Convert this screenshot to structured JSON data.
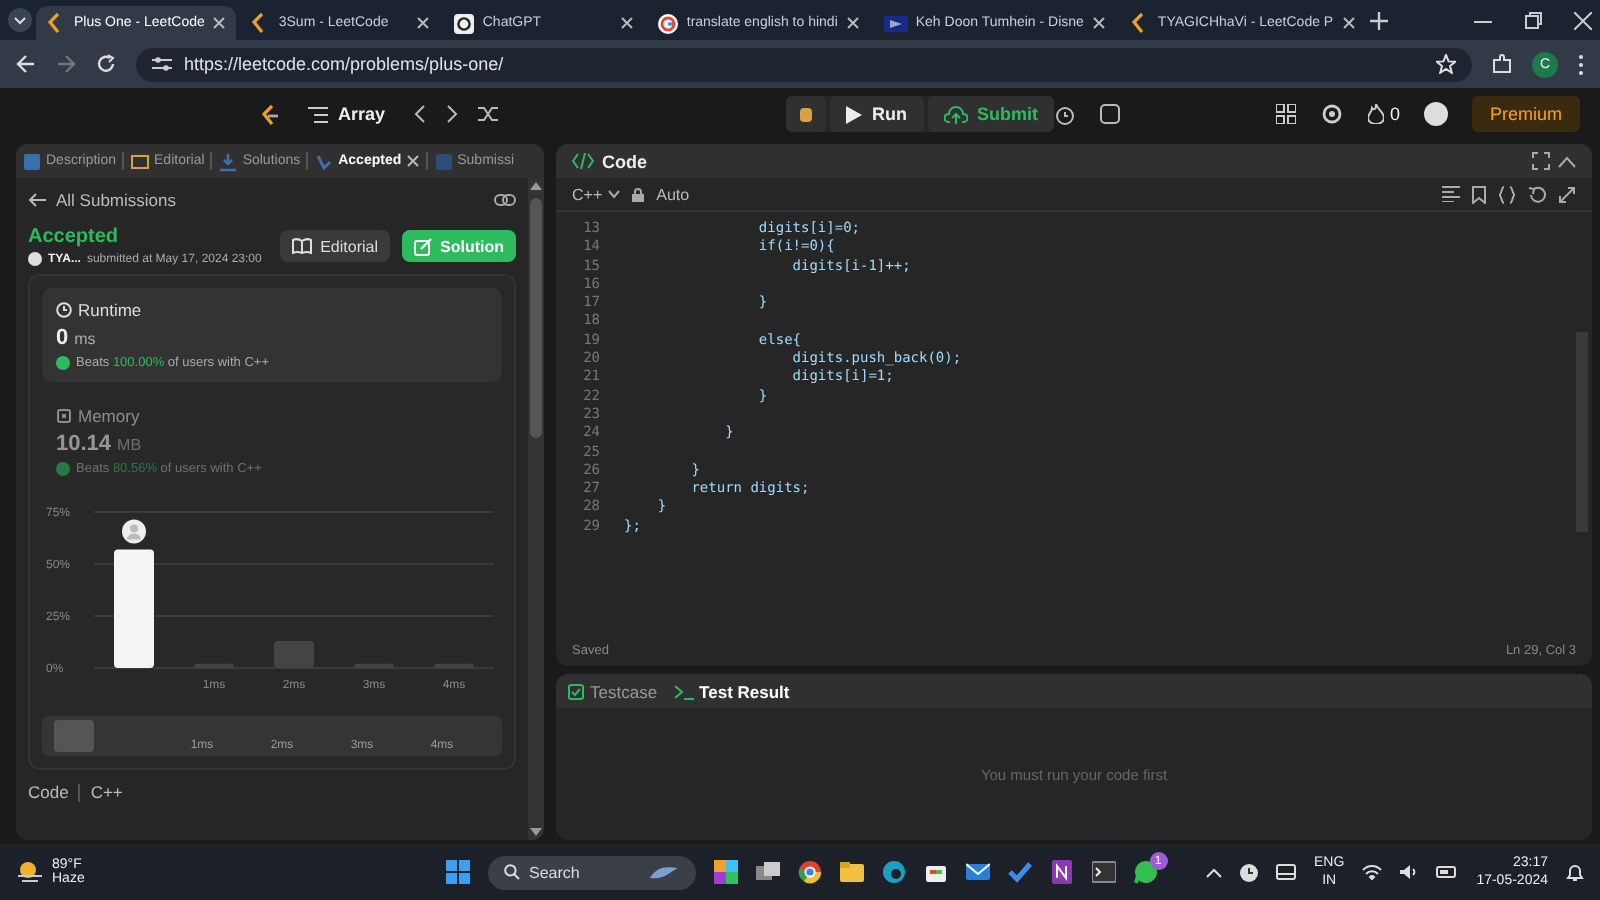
{
  "browser": {
    "tabs": [
      {
        "title": "Plus One - LeetCode",
        "selected": true,
        "kind": "leetcode"
      },
      {
        "title": "3Sum - LeetCode",
        "selected": false,
        "kind": "leetcode"
      },
      {
        "title": "ChatGPT",
        "selected": false,
        "kind": "chat"
      },
      {
        "title": "translate english to hindi",
        "selected": false,
        "kind": "search"
      },
      {
        "title": "Keh Doon Tumhein - Disne",
        "selected": false,
        "kind": "video"
      },
      {
        "title": "TYAGICHhaVi - LeetCode P",
        "selected": false,
        "kind": "leetcode"
      }
    ],
    "url": "https://leetcode.com/problems/plus-one/",
    "profile_initial": "C"
  },
  "nav": {
    "problem_list": "Array",
    "run": "Run",
    "submit": "Submit",
    "streak": "0",
    "premium": "Premium"
  },
  "left_panel": {
    "tabs": [
      {
        "label": "Description",
        "selected": false,
        "closable": false
      },
      {
        "label": "Editorial",
        "selected": false,
        "closable": false
      },
      {
        "label": "Solutions",
        "selected": false,
        "closable": false
      },
      {
        "label": "Accepted",
        "selected": true,
        "closable": true
      },
      {
        "label": "Submissi",
        "selected": false,
        "closable": false
      }
    ],
    "back_link": "All Submissions",
    "status": "Accepted",
    "user": "TYA...",
    "submitted": "submitted at May 17, 2024 23:00",
    "editorial_button": "Editorial",
    "solution_button": "Solution",
    "stats": [
      {
        "kind": "runtime",
        "title": "Runtime",
        "value": "0",
        "unit": "ms",
        "beats": "Beats",
        "percent": "100.00%",
        "suffix": "of users with C++",
        "selected": true
      },
      {
        "kind": "memory",
        "title": "Memory",
        "value": "10.14",
        "unit": "MB",
        "beats": "Beats",
        "percent": "80.56%",
        "suffix": "of users with C++",
        "selected": false
      }
    ],
    "chart_data": {
      "type": "bar",
      "x": [
        0,
        1,
        2,
        3,
        4
      ],
      "xlim": [
        -0.5,
        4.5
      ],
      "values": [
        57,
        2,
        13,
        2,
        2
      ],
      "ylim": [
        0,
        75
      ],
      "yticks": [
        {
          "value": 0,
          "label": "0%"
        },
        {
          "value": 25,
          "label": "25%"
        },
        {
          "value": 50,
          "label": "50%"
        },
        {
          "value": 75,
          "label": "75%"
        }
      ],
      "xticks": [
        {
          "value": 1,
          "label": "1ms"
        },
        {
          "value": 2,
          "label": "2ms"
        },
        {
          "value": 3,
          "label": "3ms"
        },
        {
          "value": 4,
          "label": "4ms"
        }
      ]
    },
    "range_labels": [
      "1ms",
      "2ms",
      "3ms",
      "4ms"
    ],
    "code_label": "Code",
    "code_language": "C++"
  },
  "editor": {
    "title": "Code",
    "language": "C++",
    "mode": "Auto",
    "lines": [
      {
        "number": "13",
        "text": "                digits[i]=0;"
      },
      {
        "number": "14",
        "text": "                if(i!=0){"
      },
      {
        "number": "15",
        "text": "                    digits[i-1]++;"
      },
      {
        "number": "16"
      },
      {
        "number": "17",
        "text": "                }"
      },
      {
        "number": "18"
      },
      {
        "number": "19",
        "text": "                else{"
      },
      {
        "number": "20",
        "text": "                    digits.push_back(0);"
      },
      {
        "number": "21",
        "text": "                    digits[i]=1;"
      },
      {
        "number": "22",
        "text": "                }"
      },
      {
        "number": "23"
      },
      {
        "number": "24",
        "text": "            }"
      },
      {
        "number": "25"
      },
      {
        "number": "26",
        "text": "        }"
      },
      {
        "number": "27",
        "text": "        return digits;"
      },
      {
        "number": "28",
        "text": "    }"
      },
      {
        "number": "29",
        "text": "};"
      }
    ],
    "saved": "Saved",
    "cursor": "Ln 29, Col 3"
  },
  "console": {
    "tabs": [
      {
        "label": "Testcase",
        "selected": false
      },
      {
        "label": "Test Result",
        "selected": true
      }
    ],
    "message": "You must run your code first"
  },
  "taskbar": {
    "temperature": "89°F",
    "weather": "Haze",
    "search": "Search",
    "notification_badge": "1",
    "language": "ENG",
    "region": "IN",
    "time": "23:17",
    "date": "17-05-2024"
  }
}
